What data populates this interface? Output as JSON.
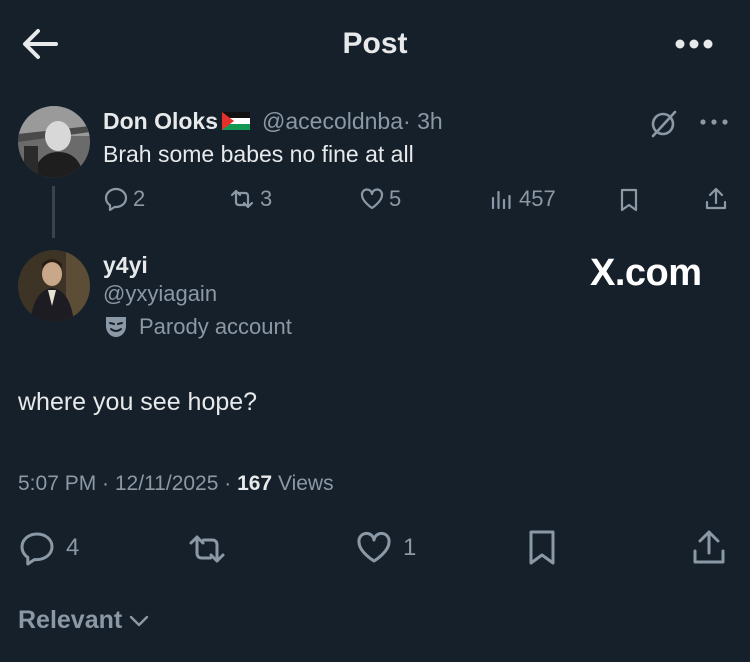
{
  "header": {
    "title": "Post",
    "back_icon": "arrow-left-icon",
    "more_icon": "more-horizontal-icon"
  },
  "quoted_post": {
    "name": "Don Oloks",
    "handle": "@acecoldnba",
    "time": "· 3h",
    "text": "Brah some babes no fine at all",
    "replies": "2",
    "reposts": "3",
    "likes": "5",
    "views": "457"
  },
  "main_post": {
    "name": "y4yi",
    "handle": "@yxyiagain",
    "badge": "Parody account",
    "text": "where you see hope?",
    "time_date": "5:07 PM · 12/11/2025 · ",
    "views_count": "167",
    "views_label": " Views",
    "replies": "4",
    "likes": "1"
  },
  "watermark": "X.com",
  "footer": {
    "sort_label": "Relevant"
  },
  "colors": {
    "background": "#15202b",
    "text": "#e7e9ea",
    "muted": "#8b98a5",
    "divider": "#38444d"
  }
}
